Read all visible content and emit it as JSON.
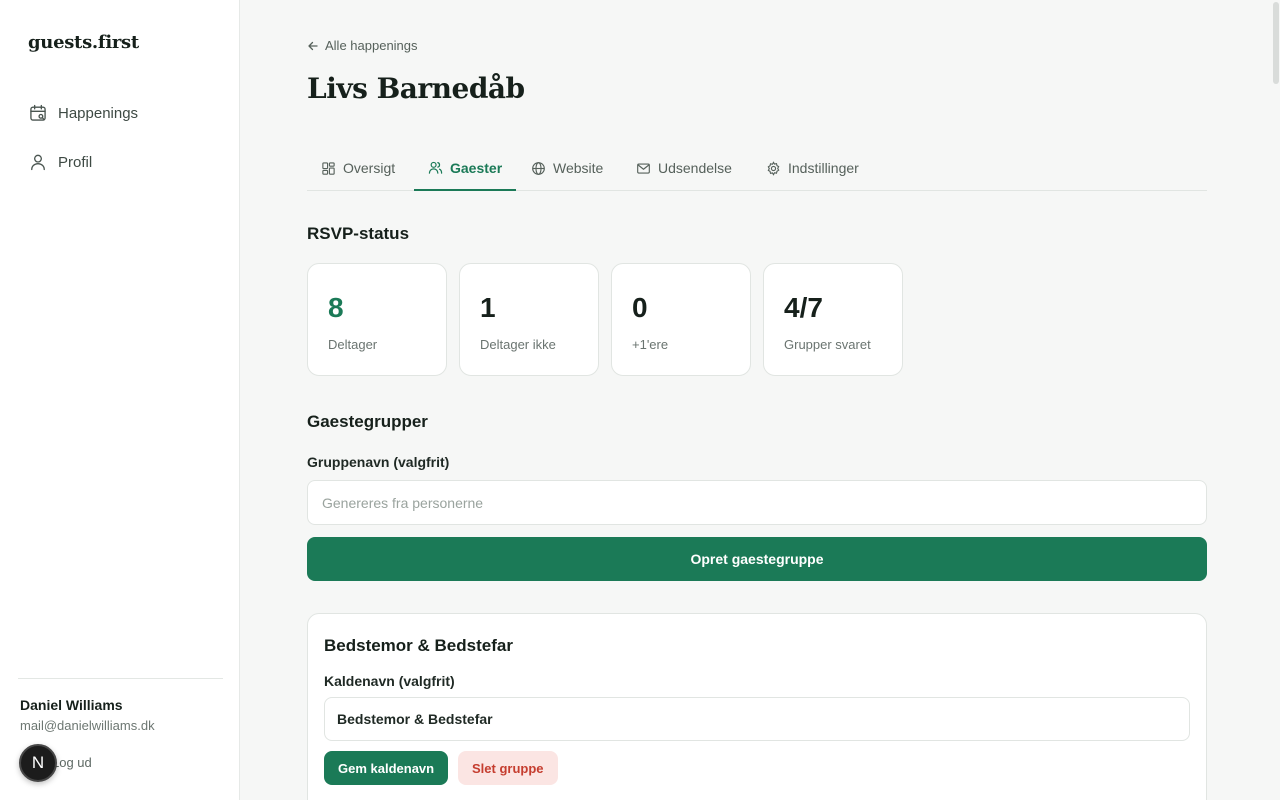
{
  "app": {
    "logo": "guests.first"
  },
  "sidebar": {
    "items": [
      {
        "label": "Happenings",
        "icon": "calendar-icon"
      },
      {
        "label": "Profil",
        "icon": "user-icon"
      }
    ],
    "user": {
      "name": "Daniel Williams",
      "email": "mail@danielwilliams.dk",
      "logout_label": "Log ud"
    },
    "badge": "N"
  },
  "header": {
    "back_label": "Alle happenings",
    "title": "Livs Barnedåb"
  },
  "tabs": [
    {
      "label": "Oversigt",
      "icon": "dashboard-icon",
      "active": false
    },
    {
      "label": "Gaester",
      "icon": "users-icon",
      "active": true
    },
    {
      "label": "Website",
      "icon": "globe-icon",
      "active": false
    },
    {
      "label": "Udsendelse",
      "icon": "mail-icon",
      "active": false
    },
    {
      "label": "Indstillinger",
      "icon": "gear-icon",
      "active": false
    }
  ],
  "rsvp": {
    "title": "RSVP-status",
    "stats": [
      {
        "value": "8",
        "label": "Deltager"
      },
      {
        "value": "1",
        "label": "Deltager ikke"
      },
      {
        "value": "0",
        "label": "+1'ere"
      },
      {
        "value": "4/7",
        "label": "Grupper svaret"
      }
    ]
  },
  "groups": {
    "title": "Gaestegrupper",
    "name_label": "Gruppenavn (valgfrit)",
    "name_placeholder": "Genereres fra personerne",
    "create_label": "Opret gaestegruppe",
    "list": [
      {
        "name": "Bedstemor & Bedstefar",
        "nick_label": "Kaldenavn (valgfrit)",
        "nick_value": "Bedstemor & Bedstefar",
        "save_label": "Gem kaldenavn",
        "delete_label": "Slet gruppe"
      }
    ]
  },
  "colors": {
    "accent": "#1b7a57",
    "danger": "#c53d2f",
    "danger_bg": "#fbe5e3"
  }
}
